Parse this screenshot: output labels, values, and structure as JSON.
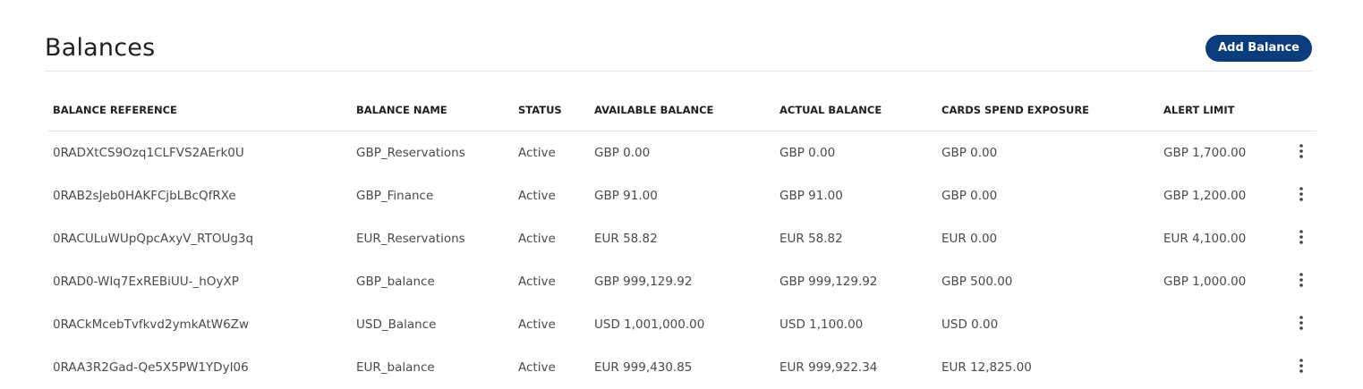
{
  "header": {
    "title": "Balances",
    "add_button_label": "Add Balance"
  },
  "colors": {
    "primary_button": "#0b3d7e"
  },
  "table": {
    "columns": [
      "BALANCE REFERENCE",
      "BALANCE NAME",
      "STATUS",
      "AVAILABLE BALANCE",
      "ACTUAL BALANCE",
      "CARDS SPEND EXPOSURE",
      "ALERT LIMIT"
    ],
    "rows": [
      {
        "reference": "0RADXtCS9Ozq1CLFVS2AErk0U",
        "name": "GBP_Reservations",
        "status": "Active",
        "available": "GBP 0.00",
        "actual": "GBP 0.00",
        "cards_exposure": "GBP 0.00",
        "alert_limit": "GBP 1,700.00",
        "action_icon": "more-vertical-icon"
      },
      {
        "reference": "0RAB2sJeb0HAKFCjbLBcQfRXe",
        "name": "GBP_Finance",
        "status": "Active",
        "available": "GBP 91.00",
        "actual": "GBP 91.00",
        "cards_exposure": "GBP 0.00",
        "alert_limit": "GBP 1,200.00",
        "action_icon": "more-vertical-icon"
      },
      {
        "reference": "0RACULuWUpQpcAxyV_RTOUg3q",
        "name": "EUR_Reservations",
        "status": "Active",
        "available": "EUR 58.82",
        "actual": "EUR 58.82",
        "cards_exposure": "EUR 0.00",
        "alert_limit": "EUR 4,100.00",
        "action_icon": "more-vertical-icon"
      },
      {
        "reference": "0RAD0-WIq7ExREBiUU-_hOyXP",
        "name": "GBP_balance",
        "status": "Active",
        "available": "GBP 999,129.92",
        "actual": "GBP 999,129.92",
        "cards_exposure": "GBP 500.00",
        "alert_limit": "GBP 1,000.00",
        "action_icon": "more-vertical-icon"
      },
      {
        "reference": "0RACkMcebTvfkvd2ymkAtW6Zw",
        "name": "USD_Balance",
        "status": "Active",
        "available": "USD 1,001,000.00",
        "actual": "USD 1,100.00",
        "cards_exposure": "USD 0.00",
        "alert_limit": "",
        "action_icon": "more-vertical-icon"
      },
      {
        "reference": "0RAA3R2Gad-Qe5X5PW1YDyI06",
        "name": "EUR_balance",
        "status": "Active",
        "available": "EUR 999,430.85",
        "actual": "EUR 999,922.34",
        "cards_exposure": "EUR 12,825.00",
        "alert_limit": "",
        "action_icon": "more-vertical-icon"
      }
    ]
  }
}
